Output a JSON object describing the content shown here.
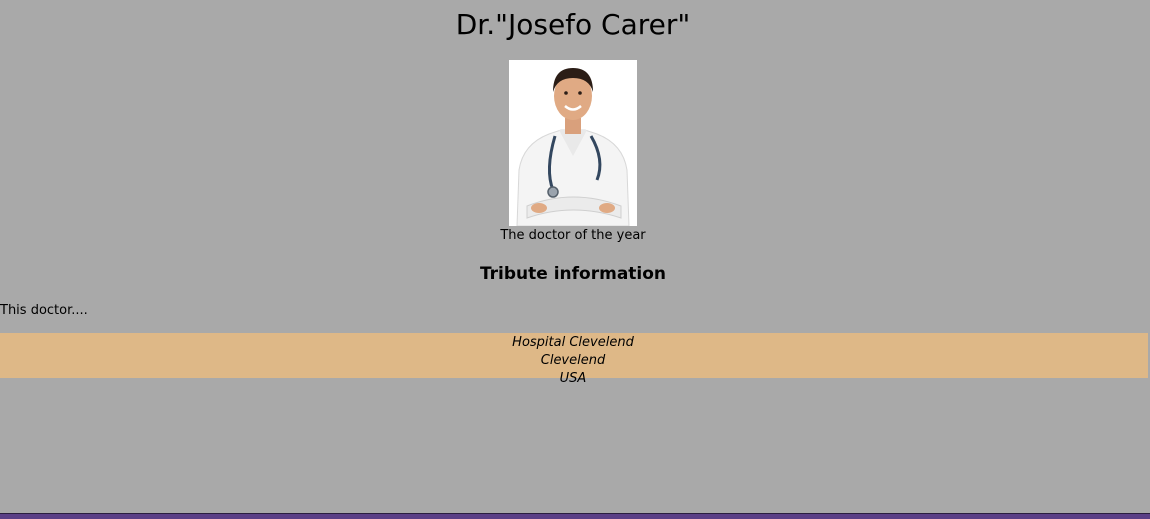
{
  "page": {
    "title": "Dr.\"Josefo Carer\"",
    "photo_caption": "The doctor of the year",
    "section_heading": "Tribute information",
    "body_text": "This doctor....",
    "address": {
      "line1": "Hospital Clevelend",
      "line2": "Clevelend",
      "line3": "USA"
    }
  },
  "colors": {
    "background": "#a9a9a9",
    "address_band": "#deb887",
    "bottom_bar": "#5b3f86"
  }
}
